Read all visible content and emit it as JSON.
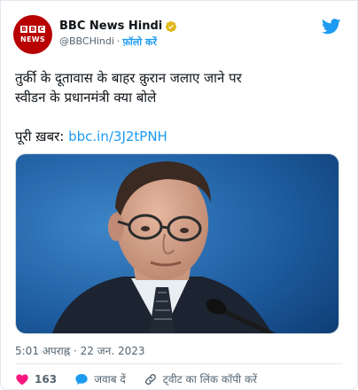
{
  "account": {
    "avatar_top": "BBC",
    "avatar_bottom": "NEWS",
    "display_name": "BBC News Hindi",
    "handle": "@BBCHindi",
    "separator": "·",
    "follow_label": "फ़ॉलो करें"
  },
  "tweet": {
    "line1": "तुर्की के दूतावास के बाहर क़ुरान जलाए जाने पर",
    "line2": "स्वीडन के प्रधानमंत्री क्या बोले",
    "link_prefix": "पूरी ख़बर: ",
    "link_text": "bbc.in/3J2tPNH"
  },
  "meta": {
    "timestamp": "5:01 अपराह्न · 22 जन. 2023"
  },
  "actions": {
    "like_count": "163",
    "reply_label": "जवाब दें",
    "copy_label": "ट्वीट का लिंक कॉपी करें"
  },
  "colors": {
    "brand_red": "#b80000",
    "twitter_blue": "#1d9bf0",
    "like_pink": "#f91880"
  }
}
